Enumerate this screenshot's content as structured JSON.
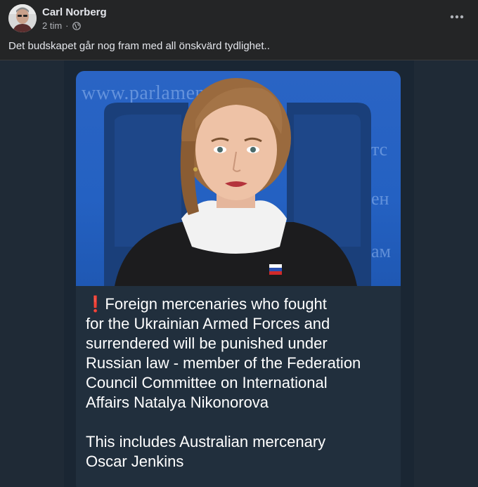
{
  "post": {
    "author": "Carl Norberg",
    "time": "2 tim",
    "separator": "·",
    "privacy_icon": "globe-icon",
    "more_icon": "more-horizontal-icon",
    "text": "Det budskapet går nog fram med all önskvärd tydlighet.."
  },
  "shared_image": {
    "background_text": "www.parlamentskaya",
    "message_marker_icon": "red-exclamation-icon",
    "message": "Foreign mercenaries who fought\nfor the Ukrainian Armed Forces and\nsurrendered will be punished under\nRussian law - member of the Federation\nCouncil Committee on International\nAffairs Natalya Nikonorova\n\nThis includes Australian mercenary\nOscar Jenkins"
  },
  "colors": {
    "background": "#242526",
    "primary_text": "#e4e6eb",
    "secondary_text": "#b0b3b8",
    "photo_blue": "#2461c2",
    "message_bubble": "#212f3d"
  }
}
